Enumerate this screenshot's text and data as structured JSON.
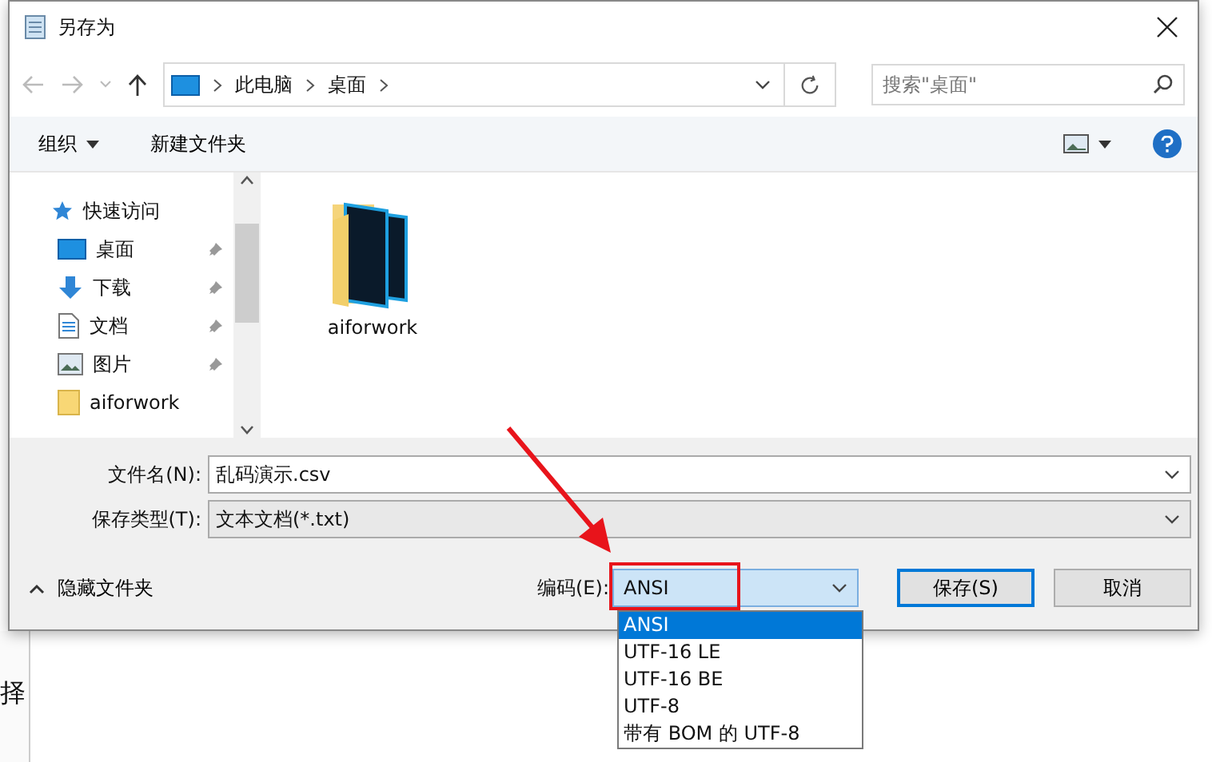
{
  "window": {
    "title": "另存为"
  },
  "address_bar": {
    "crumbs": [
      "此电脑",
      "桌面"
    ]
  },
  "search": {
    "placeholder": "搜索\"桌面\""
  },
  "toolbar": {
    "organize": "组织",
    "new_folder": "新建文件夹"
  },
  "nav_pane": {
    "items": [
      {
        "label": "快速访问",
        "kind": "group",
        "pinned": false
      },
      {
        "label": "桌面",
        "kind": "desktop",
        "pinned": true
      },
      {
        "label": "下载",
        "kind": "download",
        "pinned": true
      },
      {
        "label": "文档",
        "kind": "documents",
        "pinned": true
      },
      {
        "label": "图片",
        "kind": "pictures",
        "pinned": true
      },
      {
        "label": "aiforwork",
        "kind": "folder",
        "pinned": false
      }
    ]
  },
  "files": [
    {
      "name": "aiforwork"
    }
  ],
  "form": {
    "filename_label": "文件名(N):",
    "filename": "乱码演示.csv",
    "type_label": "保存类型(T):",
    "type": "文本文档(*.txt)",
    "hide_folders": "隐藏文件夹",
    "encoding_label": "编码(E):",
    "encoding": "ANSI",
    "save": "保存(S)",
    "cancel": "取消"
  },
  "encoding_options": [
    {
      "label": "ANSI",
      "selected": true
    },
    {
      "label": "UTF-16 LE",
      "selected": false
    },
    {
      "label": "UTF-16 BE",
      "selected": false
    },
    {
      "label": "UTF-8",
      "selected": false
    },
    {
      "label": "带有 BOM 的 UTF-8",
      "selected": false
    }
  ],
  "background": {
    "fragment": "择"
  }
}
